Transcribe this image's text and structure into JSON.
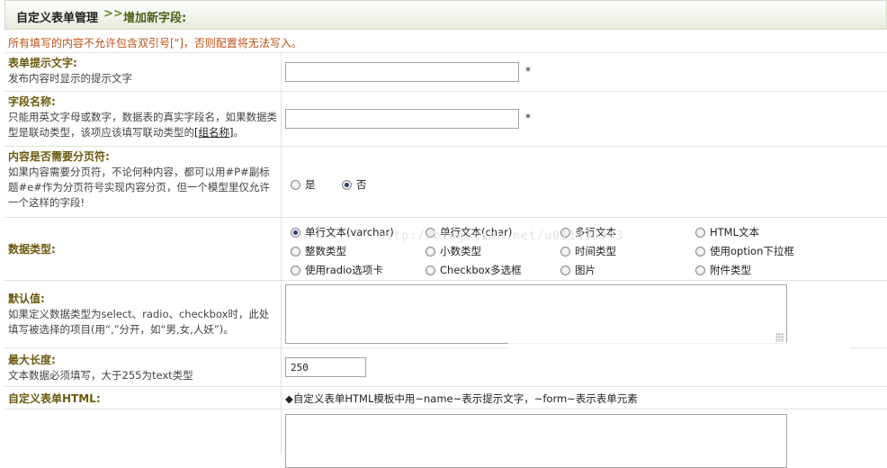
{
  "header": {
    "title": "自定义表单管理",
    "separator": ">>",
    "subtitle": "增加新字段:"
  },
  "warning": "所有填写的内容不允许包含双引号[\"]，否则配置将无法写入。",
  "field_label": {
    "title": "表单提示文字:",
    "desc": "发布内容时显示的提示文字",
    "value": "",
    "required": "*"
  },
  "field_name": {
    "title": "字段名称:",
    "desc_a": "只能用英文字母或数字，数据表的真实字段名，如果数据类型是联动类型，该项应该填写联动类型的",
    "desc_link": "[组名称]",
    "desc_b": "。",
    "value": "",
    "required": "*"
  },
  "pagination": {
    "title": "内容是否需要分页符:",
    "desc": "如果内容需要分页符，不论何种内容，都可以用#P#副标题#e#作为分页符号实现内容分页，但一个模型里仅允许一个这样的字段!",
    "options": [
      "是",
      "否"
    ],
    "selected": "否"
  },
  "data_type": {
    "title": "数据类型:",
    "options": [
      "单行文本(varchar)",
      "单行文本(char)",
      "多行文本",
      "HTML文本",
      "整数类型",
      "小数类型",
      "时间类型",
      "使用option下拉框",
      "使用radio选项卡",
      "Checkbox多选框",
      "图片",
      "附件类型"
    ],
    "selected": "单行文本(varchar)"
  },
  "default_value": {
    "title": "默认值:",
    "desc": "如果定义数据类型为select、radio、checkbox时，此处填写被选择的项目(用“,”分开，如“男,女,人妖”)。",
    "value": ""
  },
  "max_length": {
    "title": "最大长度:",
    "desc": "文本数据必须填写，大于255为text类型",
    "value": "250"
  },
  "custom_html": {
    "title": "自定义表单HTML:",
    "hint": "◆自定义表单HTML模板中用~name~表示提示文字，~form~表示表单元素"
  },
  "watermark": "http://blog.csdn.net/u011435743"
}
